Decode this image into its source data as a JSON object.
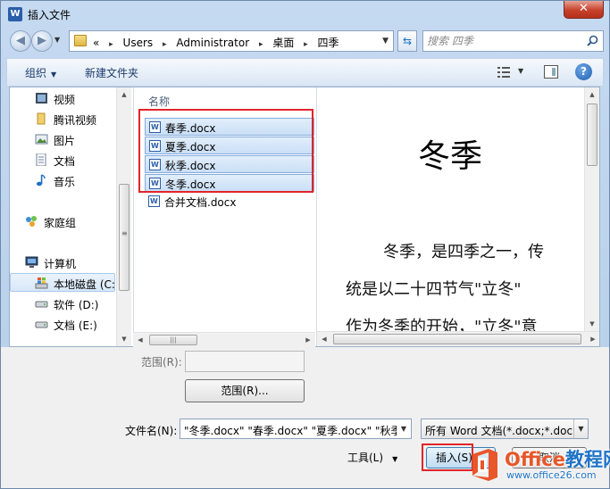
{
  "window": {
    "title": "插入文件",
    "close_label": "✕",
    "app_icon_letter": "W"
  },
  "address": {
    "hist": "«",
    "crumbs": [
      "Users",
      "Administrator",
      "桌面",
      "四季"
    ],
    "sep": "▸"
  },
  "search": {
    "placeholder": "搜索 四季"
  },
  "toolbar": {
    "organize": "组织",
    "new_folder": "新建文件夹"
  },
  "nav": {
    "items": [
      {
        "label": "视频",
        "icon": "video-icon"
      },
      {
        "label": "腾讯视频",
        "icon": "folder-icon"
      },
      {
        "label": "图片",
        "icon": "picture-icon"
      },
      {
        "label": "文档",
        "icon": "document-icon"
      },
      {
        "label": "音乐",
        "icon": "music-icon"
      },
      {
        "label": "家庭组",
        "icon": "homegroup-icon"
      },
      {
        "label": "计算机",
        "icon": "computer-icon"
      },
      {
        "label": "本地磁盘 (C:)",
        "icon": "drive-icon"
      },
      {
        "label": "软件 (D:)",
        "icon": "drive-icon"
      },
      {
        "label": "文档 (E:)",
        "icon": "drive-icon"
      }
    ]
  },
  "files": {
    "column_name": "名称",
    "rows": [
      {
        "name": "春季.docx",
        "selected": true
      },
      {
        "name": "夏季.docx",
        "selected": true
      },
      {
        "name": "秋季.docx",
        "selected": true
      },
      {
        "name": "冬季.docx",
        "selected": true
      },
      {
        "name": "合并文档.docx",
        "selected": false
      }
    ]
  },
  "preview": {
    "title": "冬季",
    "lines": [
      "冬季，是四季之一，传",
      "统是以二十四节气\"立冬\"",
      "作为冬季的开始，\"立冬\"意"
    ]
  },
  "bottom": {
    "range_label": "范围(R):",
    "range_button": "范围(R)...",
    "filename_label": "文件名(N):",
    "filename_value": "\"冬季.docx\" \"春季.docx\" \"夏季.docx\" \"秋季",
    "filter_value": "所有 Word 文档(*.docx;*.doc",
    "tools_label": "工具(L)",
    "insert_label": "插入(S)",
    "cancel_label": "取消"
  },
  "watermark": {
    "brand_a": "Office",
    "brand_b": "教程网",
    "url": "www.office26.com"
  },
  "colors": {
    "accent": "#1f73c7",
    "selection_border": "#e0252a",
    "brand_orange": "#e8562a"
  }
}
